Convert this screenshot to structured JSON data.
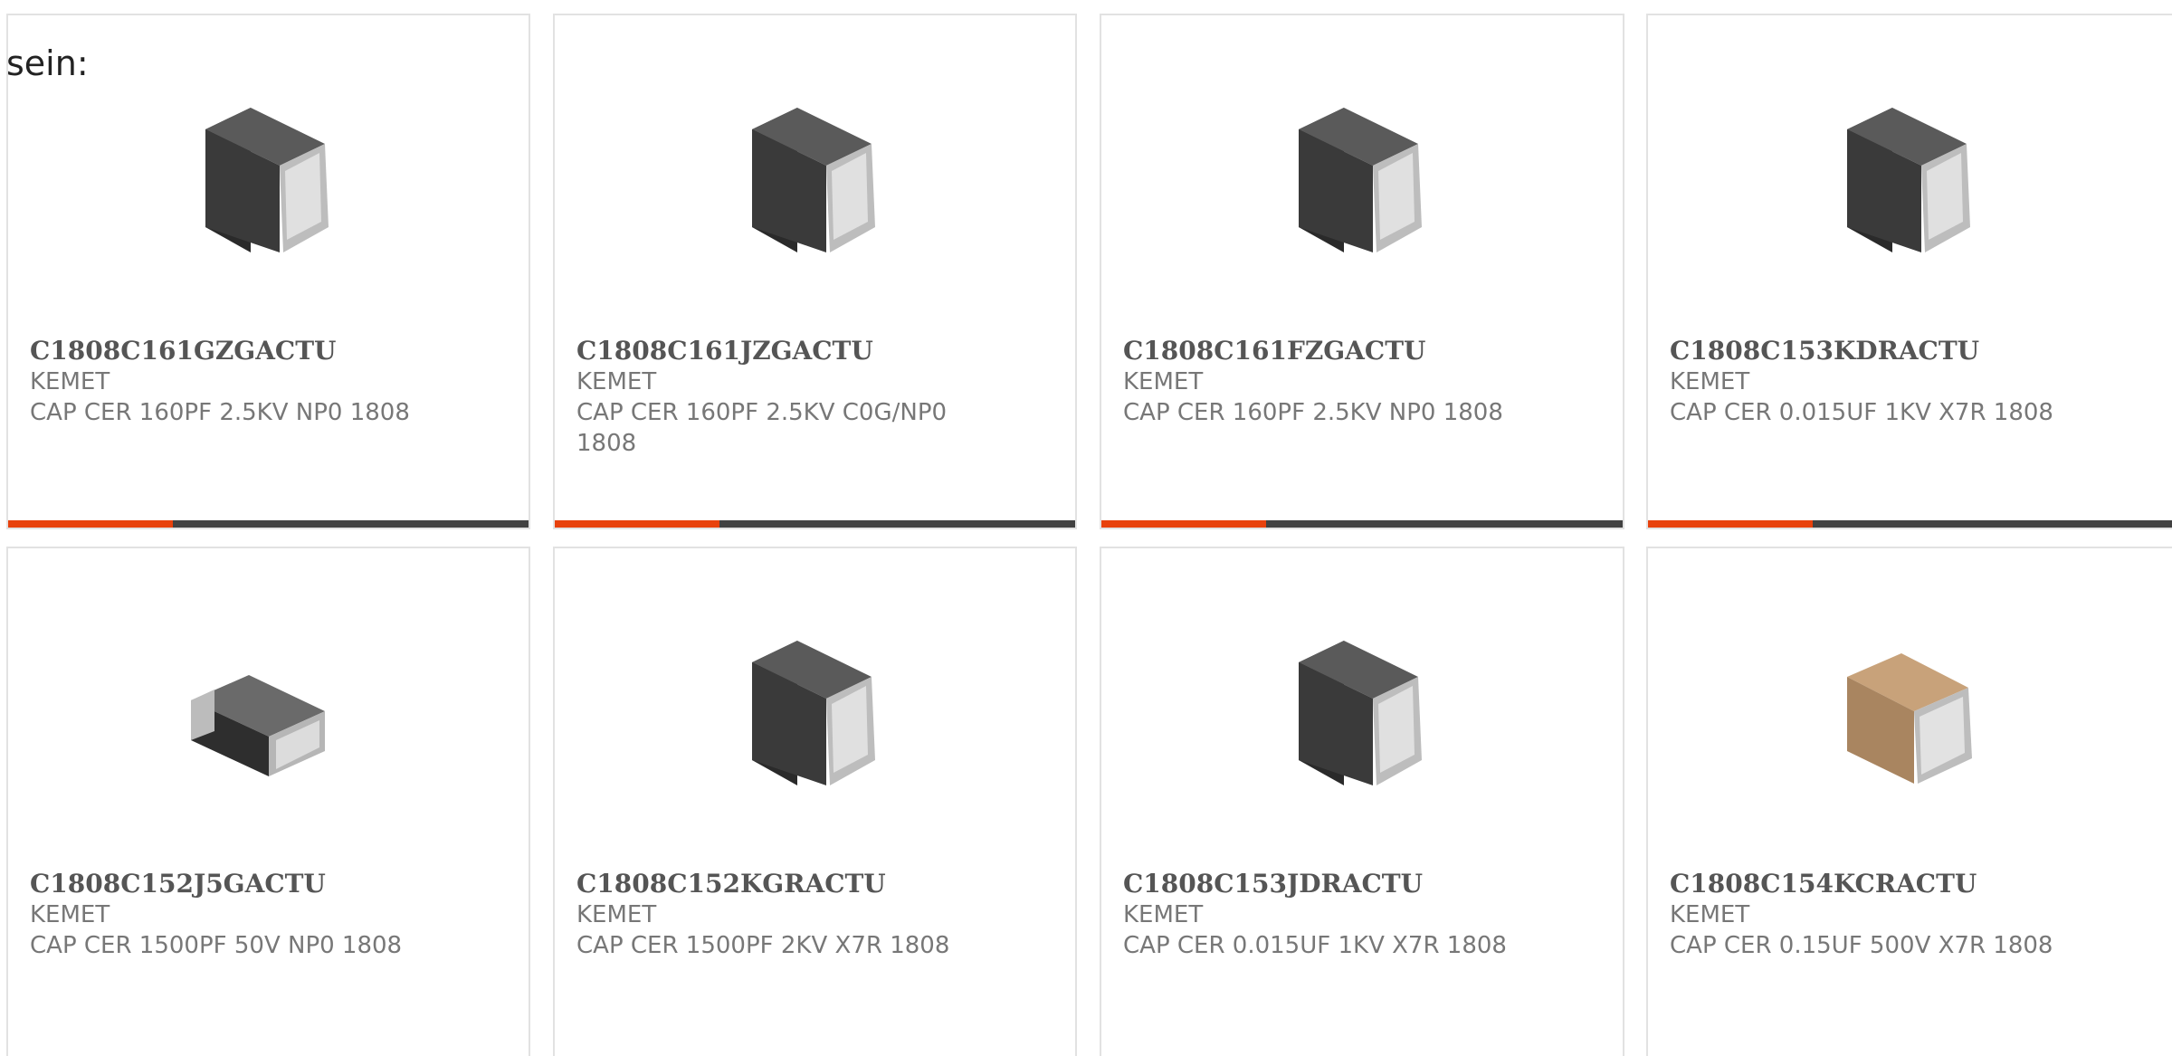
{
  "intro_text": "sein:",
  "colors": {
    "accent": "#e8410c",
    "bar": "#414141",
    "border": "#e2e2e2",
    "part_text": "#555555",
    "body_text": "#777777"
  },
  "products": [
    {
      "part": "C1808C161GZGACTU",
      "mfr": "KEMET",
      "desc": "CAP CER 160PF 2.5KV NP0 1808",
      "image": "dark-ceramic-capacitor-upright-icon"
    },
    {
      "part": "C1808C161JZGACTU",
      "mfr": "KEMET",
      "desc": "CAP CER 160PF 2.5KV C0G/NP0 1808",
      "image": "dark-ceramic-capacitor-upright-icon"
    },
    {
      "part": "C1808C161FZGACTU",
      "mfr": "KEMET",
      "desc": "CAP CER 160PF 2.5KV NP0 1808",
      "image": "dark-ceramic-capacitor-upright-icon"
    },
    {
      "part": "C1808C153KDRACTU",
      "mfr": "KEMET",
      "desc": "CAP CER 0.015UF 1KV X7R 1808",
      "image": "dark-ceramic-capacitor-upright-icon"
    },
    {
      "part": "C1808C152J5GACTU",
      "mfr": "KEMET",
      "desc": "CAP CER 1500PF 50V NP0 1808",
      "image": "dark-ceramic-capacitor-flat-icon"
    },
    {
      "part": "C1808C152KGRACTU",
      "mfr": "KEMET",
      "desc": "CAP CER 1500PF 2KV X7R 1808",
      "image": "dark-ceramic-capacitor-upright-icon"
    },
    {
      "part": "C1808C153JDRACTU",
      "mfr": "KEMET",
      "desc": "CAP CER 0.015UF 1KV X7R 1808",
      "image": "dark-ceramic-capacitor-upright-icon"
    },
    {
      "part": "C1808C154KCRACTU",
      "mfr": "KEMET",
      "desc": "CAP CER 0.15UF 500V X7R 1808",
      "image": "tan-ceramic-capacitor-icon"
    }
  ]
}
